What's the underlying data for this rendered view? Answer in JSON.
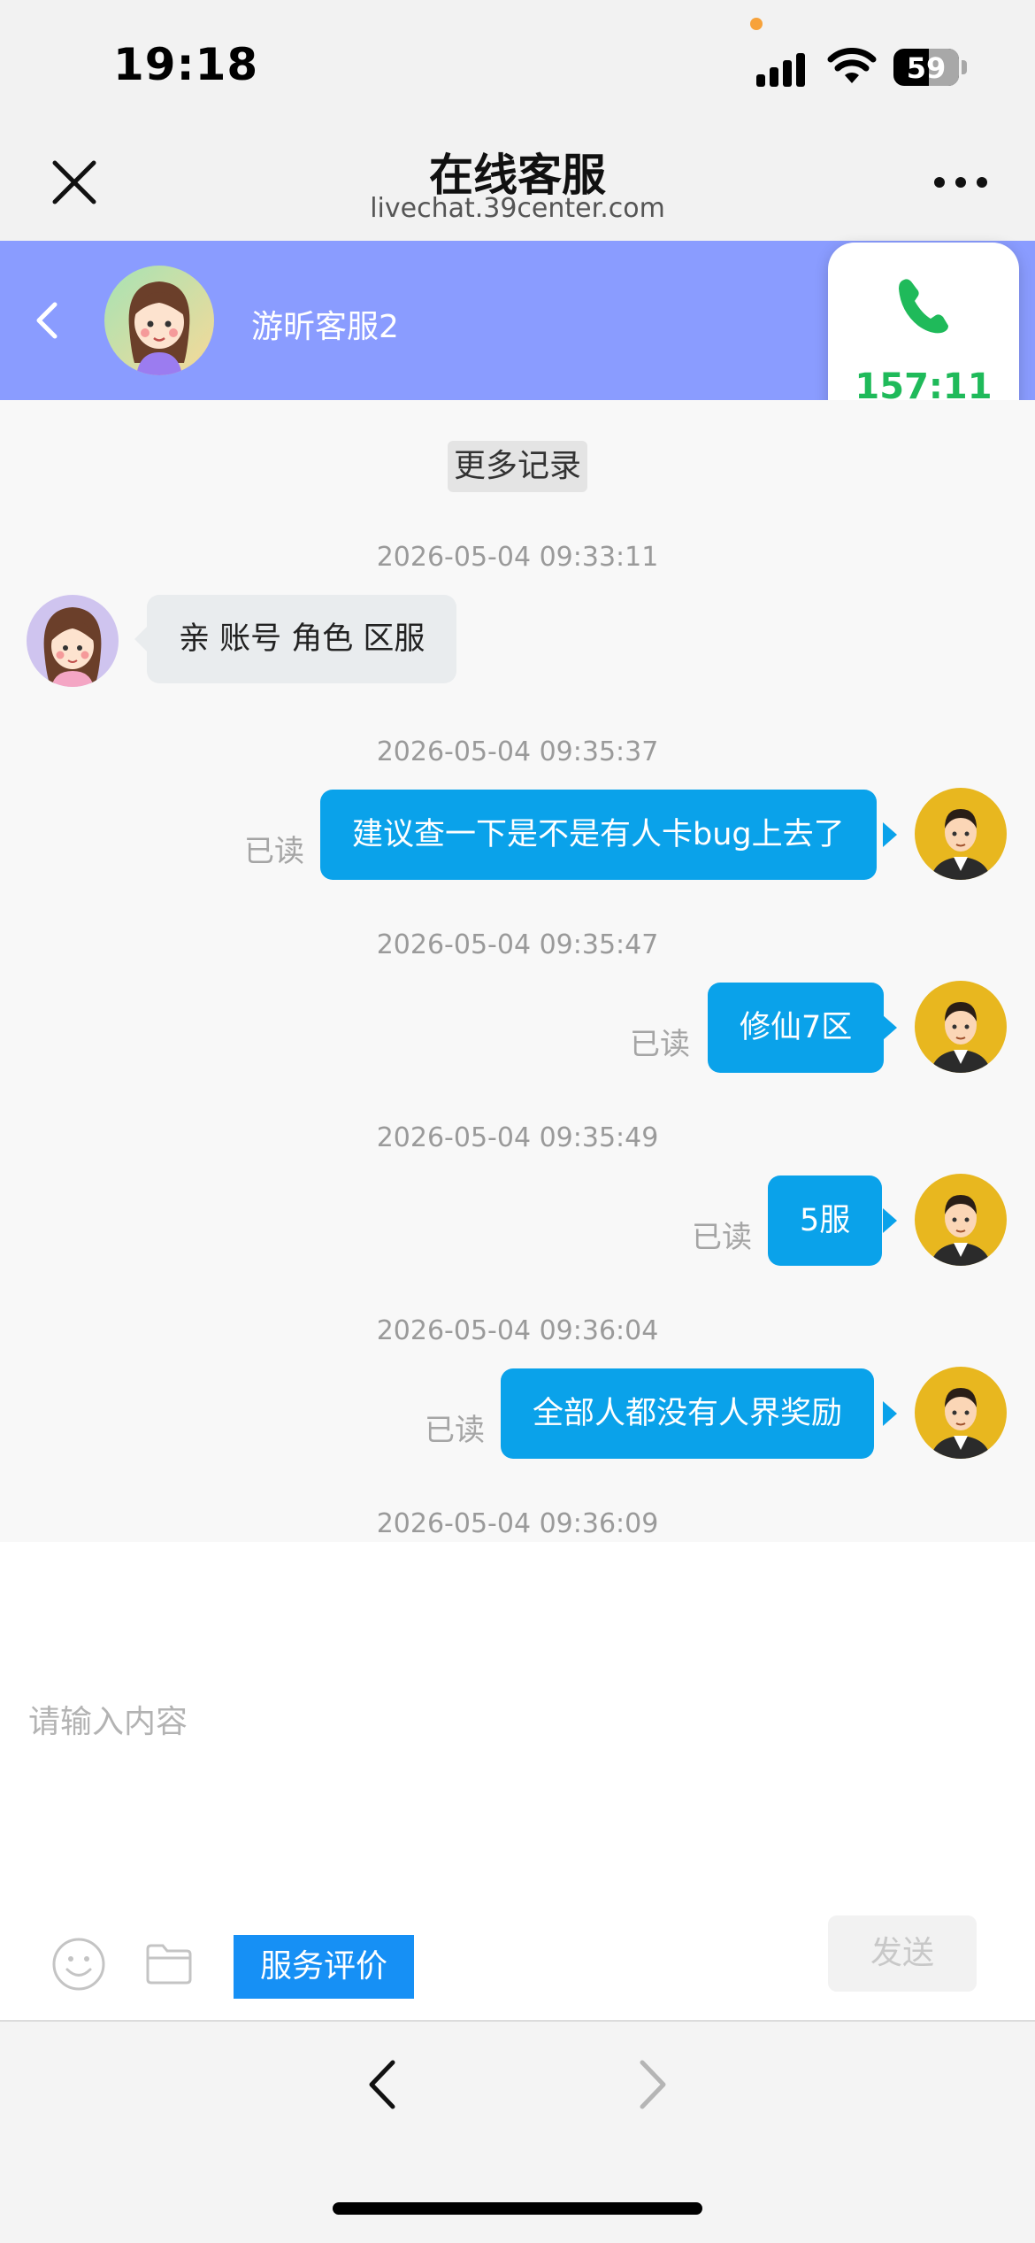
{
  "status_bar": {
    "time": "19:18",
    "battery": "59"
  },
  "browser": {
    "title": "在线客服",
    "url": "livechat.39center.com"
  },
  "chat_header": {
    "agent_name": "游昕客服2",
    "call_timer": "157:11",
    "call_color": "#1fba5a",
    "header_color": "#8a9cff"
  },
  "chat": {
    "more_records": "更多记录",
    "messages": [
      {
        "timestamp": "2026-05-04 09:33:11",
        "side": "agent",
        "text": "亲 账号 角色 区服"
      },
      {
        "timestamp": "2026-05-04 09:35:37",
        "side": "user",
        "text": "建议查一下是不是有人卡bug上去了",
        "status": "已读"
      },
      {
        "timestamp": "2026-05-04 09:35:47",
        "side": "user",
        "text": "修仙7区",
        "status": "已读"
      },
      {
        "timestamp": "2026-05-04 09:35:49",
        "side": "user",
        "text": "5服",
        "status": "已读"
      },
      {
        "timestamp": "2026-05-04 09:36:04",
        "side": "user",
        "text": "全部人都没有人界奖励",
        "status": "已读"
      },
      {
        "timestamp": "2026-05-04 09:36:09"
      }
    ]
  },
  "input": {
    "placeholder": "请输入内容",
    "rate_label": "服务评价",
    "send_label": "发送",
    "accent_color": "#1690f5"
  },
  "icons": [
    "close-icon",
    "more-icon",
    "back-chevron-icon",
    "phone-icon",
    "emoji-icon",
    "folder-icon",
    "nav-back-icon",
    "nav-forward-icon"
  ]
}
